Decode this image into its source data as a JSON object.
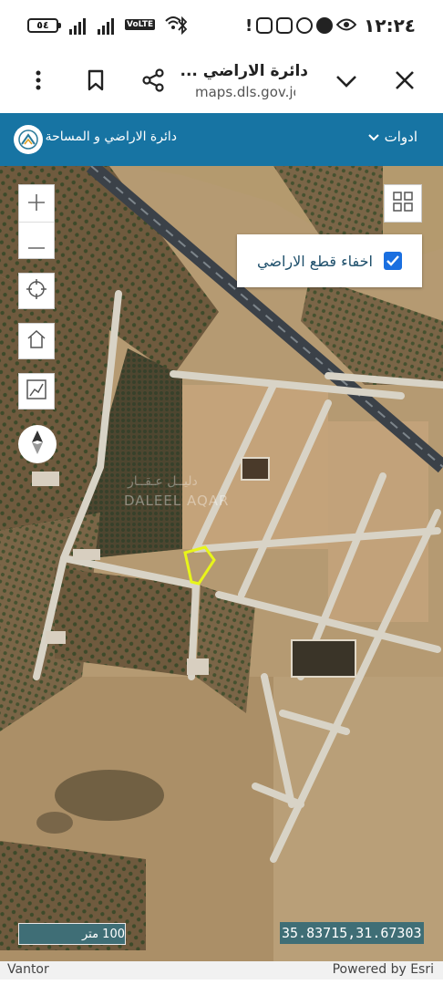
{
  "status_bar": {
    "battery": "٥٤",
    "volte": "VoLTE",
    "time": "١٢:٢٤"
  },
  "browser": {
    "page_title": "دائرة الاراضي ...",
    "url": "maps.dls.gov.jo"
  },
  "app_bar": {
    "name": "دائرة الاراضي و المساحة",
    "tools_label": "ادوات"
  },
  "map": {
    "layer_toggle_label": "اخفاء قطع الاراضي",
    "layer_toggle_checked": true,
    "watermark_arabic": "دليــل عـقــار",
    "watermark_latin": "DALEEL AQAR",
    "scale_label": "100 متر",
    "coordinates": "35.83715,31.67303",
    "highlight_color": "#e8f51a"
  },
  "attribution": {
    "left": "Vantor",
    "right": "Powered by Esri"
  }
}
